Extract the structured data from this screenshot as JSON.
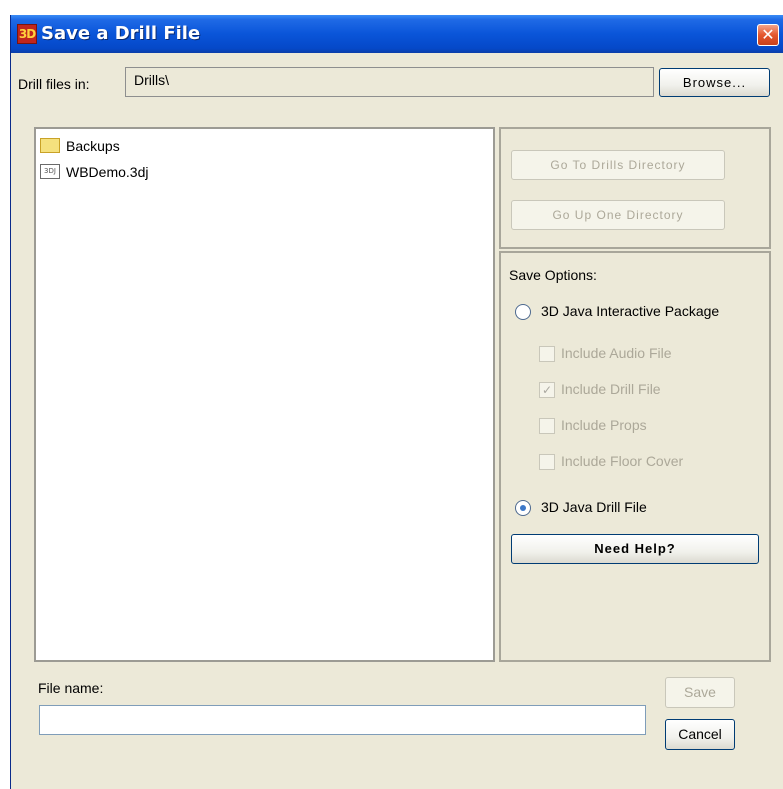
{
  "window": {
    "title": "Save a Drill File",
    "app_icon_text": "3D",
    "close_symbol": "✕"
  },
  "location": {
    "label": "Drill files in:",
    "path": "Drills\\",
    "browse_label": "Browse..."
  },
  "files": [
    {
      "name": "Backups",
      "icon": "folder-icon"
    },
    {
      "name": "WBDemo.3dj",
      "icon": "drill-file-icon",
      "icon_text": "3DJ"
    }
  ],
  "nav": {
    "go_to_drills": "Go To Drills Directory",
    "go_up": "Go Up One Directory"
  },
  "options": {
    "heading": "Save Options:",
    "interactive_package": {
      "label": "3D Java Interactive Package",
      "selected": false
    },
    "include_audio": {
      "label": "Include Audio File",
      "checked": false
    },
    "include_drill": {
      "label": "Include Drill File",
      "checked": true,
      "mark": "✓"
    },
    "include_props": {
      "label": "Include Props",
      "checked": false
    },
    "include_floor": {
      "label": "Include Floor Cover",
      "checked": false
    },
    "drill_file": {
      "label": "3D Java Drill File",
      "selected": true
    },
    "help_label": "Need Help?"
  },
  "footer": {
    "file_name_label": "File name:",
    "file_name_value": "",
    "save_label": "Save",
    "cancel_label": "Cancel"
  },
  "colors": {
    "titlebar": "#0a55d9",
    "dialog_bg": "#ece9d8",
    "disabled_text": "#aca899",
    "close_button": "#e4572e"
  }
}
